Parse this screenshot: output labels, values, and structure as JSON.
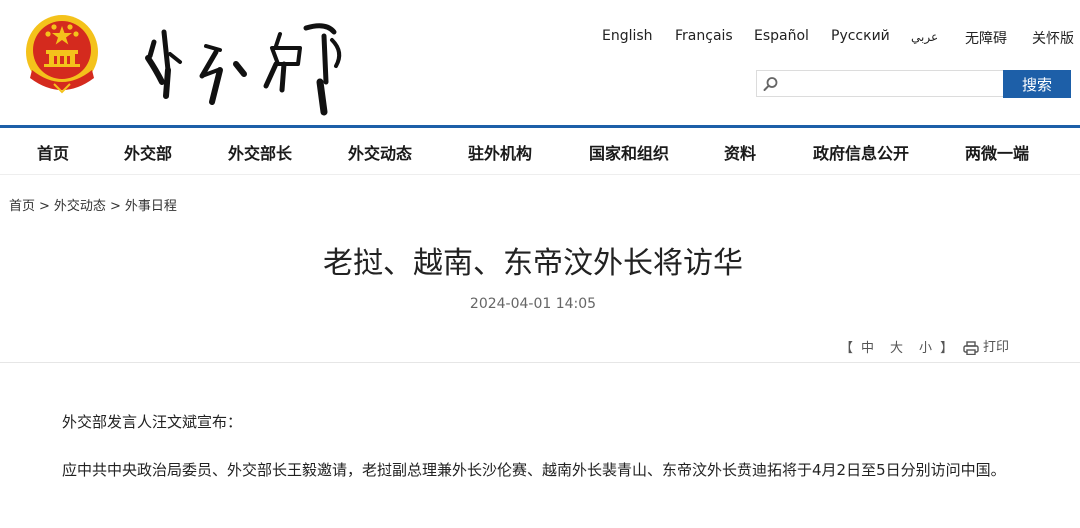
{
  "header": {
    "languages": [
      "English",
      "Français",
      "Español",
      "Русский",
      "عربي",
      "无障碍",
      "关怀版"
    ],
    "search": {
      "placeholder": "",
      "button_label": "搜索"
    }
  },
  "nav": {
    "items": [
      "首页",
      "外交部",
      "外交部长",
      "外交动态",
      "驻外机构",
      "国家和组织",
      "资料",
      "政府信息公开",
      "两微一端"
    ]
  },
  "breadcrumb": {
    "items": [
      "首页",
      "外交动态",
      "外事日程"
    ],
    "separator": ">"
  },
  "article": {
    "title": "老挝、越南、东帝汶外长将访华",
    "date": "2024-04-01 14:05",
    "font_size": {
      "open": "【",
      "options": [
        "中",
        "大",
        "小"
      ],
      "close": "】"
    },
    "print_label": "打印",
    "paragraphs": [
      "外交部发言人汪文斌宣布：",
      "应中共中央政治局委员、外交部长王毅邀请，老挝副总理兼外长沙伦赛、越南外长裴青山、东帝汶外长贲迪拓将于4月2日至5日分别访问中国。"
    ]
  },
  "colors": {
    "brand_blue": "#1d5fa8",
    "emblem_red": "#d42a1e",
    "emblem_gold": "#f4c21b"
  }
}
